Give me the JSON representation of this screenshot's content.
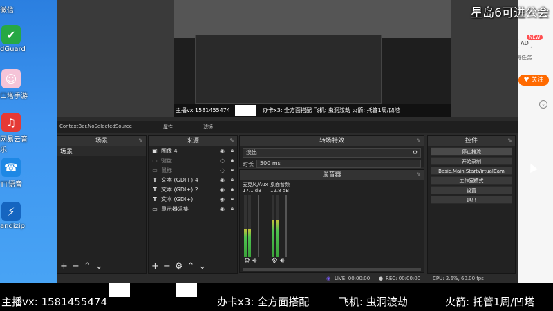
{
  "desktop_icons": [
    {
      "label": "微信",
      "icon": "wechat-icon",
      "color": "#2aae67"
    },
    {
      "label": "dGuard",
      "icon": "shield-icon",
      "color": "#27a844"
    },
    {
      "label": "口塔手游",
      "icon": "game-icon",
      "color": "#f5c4d8"
    },
    {
      "label": "网易云音乐",
      "icon": "music-icon",
      "color": "#e53935"
    },
    {
      "label": "TT语音",
      "icon": "voice-icon",
      "color": "#1e88e5"
    },
    {
      "label": "andizip",
      "icon": "zip-icon",
      "color": "#1565c0"
    }
  ],
  "overlay_top": "星岛6可进公会",
  "right_page": {
    "new_badge": "NEW",
    "ad": "AD",
    "task": "海任务",
    "follow": "关注"
  },
  "preview": {
    "host": "主播vx",
    "phone": "1581455474",
    "tag": "办卡x3: 全方面搭配  飞机: 虫洞渡劫  火箭: 托管1周/凹塔"
  },
  "dock_titlebar": {
    "context": "ContextBar.NoSelectedSource",
    "properties": "属性",
    "filters": "滤镜"
  },
  "scenes": {
    "title": "场景",
    "items": [
      "场景"
    ]
  },
  "sources": {
    "title": "来源",
    "items": [
      {
        "label": "图像 4",
        "icon": "image-icon"
      },
      {
        "label": "键盘",
        "icon": "file-icon"
      },
      {
        "label": "鼠标",
        "icon": "file-icon"
      },
      {
        "label": "文本 (GDI+) 4",
        "icon": "text-icon"
      },
      {
        "label": "文本 (GDI+) 2",
        "icon": "text-icon"
      },
      {
        "label": "文本 (GDI+)",
        "icon": "text-icon"
      },
      {
        "label": "显示器采集",
        "icon": "monitor-icon"
      }
    ]
  },
  "transitions": {
    "title": "转场特效",
    "selected": "淡出",
    "duration_label": "时长",
    "duration_value": "500 ms"
  },
  "mixer": {
    "title": "混音器",
    "channels": [
      {
        "name": "麦克风/Aux",
        "db": "17.1 dB",
        "level": 0.45
      },
      {
        "name": "桌面音频",
        "db": "12.8 dB",
        "level": 0.6
      }
    ]
  },
  "controls": {
    "title": "控件",
    "buttons": [
      "停止推流",
      "开始录制",
      "Basic.Main.StartVirtualCam",
      "工作室模式",
      "设置",
      "退出"
    ]
  },
  "status": {
    "live": "LIVE: 00:00:00",
    "rec": "REC: 00:00:00",
    "cpu": "CPU: 2.6%, 60.00 fps"
  },
  "ticker": {
    "host": "主播vx: 1581455474",
    "card": "办卡x3: 全方面搭配",
    "plane": "飞机: 虫洞渡劫",
    "rocket": "火箭: 托管1周/凹塔"
  }
}
